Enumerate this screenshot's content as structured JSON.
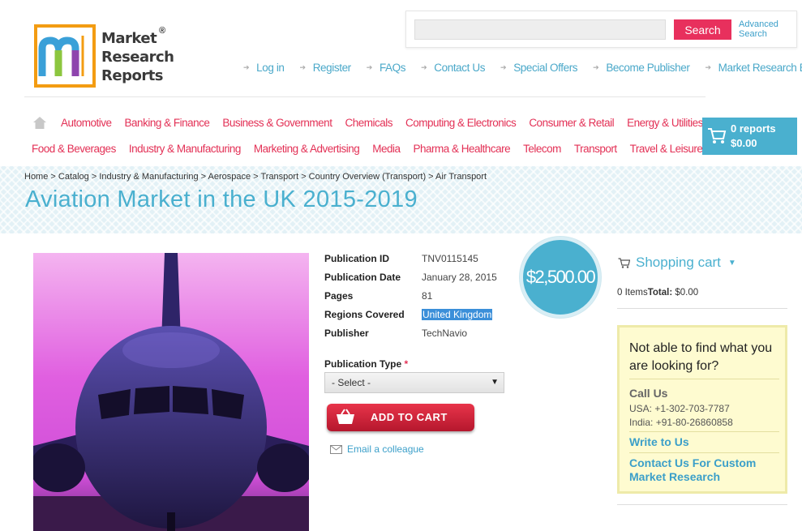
{
  "logo": {
    "line1": "Market",
    "line2": "Research",
    "line3": "Reports",
    "mark": "®"
  },
  "search": {
    "placeholder": "",
    "button": "Search",
    "advanced_line1": "Advanced",
    "advanced_line2": "Search"
  },
  "top_links": [
    "Log in",
    "Register",
    "FAQs",
    "Contact Us",
    "Special Offers",
    "Become Publisher",
    "Market Research Blog"
  ],
  "nav": {
    "row1": [
      "Automotive",
      "Banking & Finance",
      "Business & Government",
      "Chemicals",
      "Computing & Electronics",
      "Consumer & Retail",
      "Energy & Utilities"
    ],
    "row2": [
      "Food & Beverages",
      "Industry & Manufacturing",
      "Marketing & Advertising",
      "Media",
      "Pharma & Healthcare",
      "Telecom",
      "Transport",
      "Travel & Leisure"
    ]
  },
  "cart_box": {
    "count": "0 reports",
    "total": "$0.00"
  },
  "breadcrumb": "Home > Catalog > Industry & Manufacturing > Aerospace > Transport > Country Overview (Transport) > Air Transport",
  "title": "Aviation Market in the UK 2015-2019",
  "details": [
    {
      "label": "Publication ID",
      "value": "TNV0115145"
    },
    {
      "label": "Publication Date",
      "value": "January 28, 2015"
    },
    {
      "label": "Pages",
      "value": "81"
    },
    {
      "label": "Regions Covered",
      "value": "United Kingdom"
    },
    {
      "label": "Publisher",
      "value": "TechNavio"
    }
  ],
  "price": "$2,500.00",
  "publication_type": {
    "label": "Publication Type",
    "required": "*",
    "selected": "- Select -"
  },
  "add_to_cart": "ADD TO CART",
  "email_link": "Email a colleague",
  "shopping_cart": {
    "title": "Shopping cart",
    "items": "0 Items",
    "total_label": "Total:",
    "total_value": "$0.00"
  },
  "help": {
    "title": "Not able to find what you are looking for?",
    "call_us": "Call Us",
    "phone_usa": "USA: +1-302-703-7787",
    "phone_india": "India: +91-80-26860858",
    "write_us": "Write to Us",
    "contact_custom": "Contact Us For Custom Market Research"
  },
  "colors": {
    "accent_blue": "#4ab0cf",
    "nav_red": "#e33156",
    "logo_orange": "#f39c12",
    "cart_red": "#d42639"
  },
  "icons": [
    "home-icon",
    "cart-icon",
    "envelope-icon",
    "chevron-down-icon",
    "arrow-icon"
  ]
}
